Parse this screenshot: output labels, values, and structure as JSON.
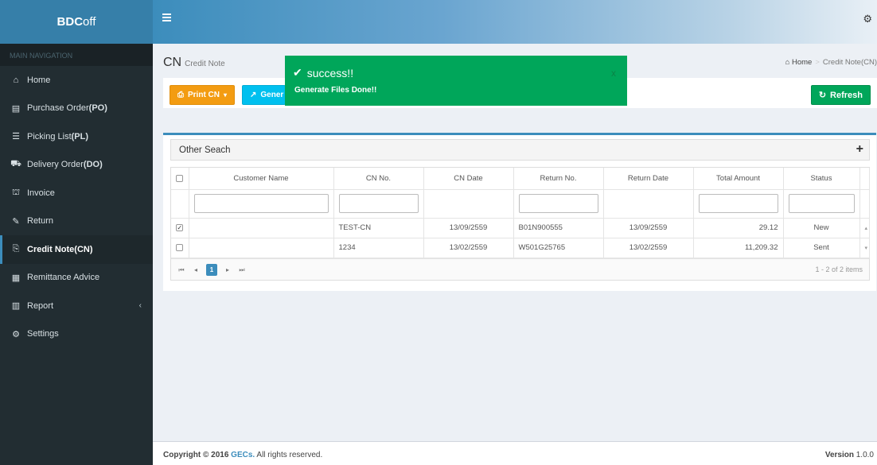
{
  "brand": {
    "bold": "BDC",
    "rest": "off"
  },
  "sidebar": {
    "header": "MAIN NAVIGATION",
    "items": [
      {
        "icon": "home-icon",
        "label": "Home",
        "abbr": ""
      },
      {
        "icon": "file-icon",
        "label": "Purchase Order ",
        "abbr": "(PO)"
      },
      {
        "icon": "list-icon",
        "label": "Picking List ",
        "abbr": "(PL)"
      },
      {
        "icon": "truck-icon",
        "label": "Delivery Order ",
        "abbr": "(DO)"
      },
      {
        "icon": "bank-icon",
        "label": "Invoice",
        "abbr": ""
      },
      {
        "icon": "edit-icon",
        "label": "Return",
        "abbr": ""
      },
      {
        "icon": "credit-note-icon",
        "label": "Credit Note ",
        "abbr": "(CN)"
      },
      {
        "icon": "calendar-icon",
        "label": "Remittance Advice",
        "abbr": ""
      },
      {
        "icon": "chart-icon",
        "label": "Report",
        "abbr": ""
      },
      {
        "icon": "settings-icon",
        "label": "Settings",
        "abbr": ""
      }
    ],
    "active_index": 6
  },
  "header": {
    "title": "CN",
    "subtitle": "Credit Note"
  },
  "breadcrumb": {
    "home": "Home",
    "current": "Credit Note(CN)"
  },
  "toolbar": {
    "print_label": "Print CN",
    "generate_label": "Gener",
    "refresh_label": "Refresh"
  },
  "toast": {
    "title": "success!!",
    "message": "Generate Files Done!!",
    "close": "x"
  },
  "search": {
    "label": "Other Seach",
    "toggle": "+"
  },
  "grid": {
    "columns": [
      "Customer Name",
      "CN No.",
      "CN Date",
      "Return No.",
      "Return Date",
      "Total Amount",
      "Status"
    ],
    "rows": [
      {
        "checked": true,
        "customer": "",
        "cn_no": "TEST-CN",
        "cn_date": "13/09/2559",
        "return_no": "B01N900555",
        "return_date": "13/09/2559",
        "total": "29.12",
        "status": "New"
      },
      {
        "checked": false,
        "customer": "",
        "cn_no": "1234",
        "cn_date": "13/02/2559",
        "return_no": "W501G25765",
        "return_date": "13/02/2559",
        "total": "11,209.32",
        "status": "Sent"
      }
    ],
    "pager": {
      "current_page": "1",
      "info": "1 - 2 of 2 items"
    }
  },
  "footer": {
    "copy_prefix": "Copyright © 2016 ",
    "company": "GECs.",
    "copy_suffix": " All rights reserved.",
    "version_label": "Version",
    "version": " 1.0.0"
  },
  "colors": {
    "sidebar": "#222d32",
    "brand": "#367fa9",
    "primary": "#3c8dbc",
    "success": "#00a65a",
    "warning": "#f39c12",
    "info": "#00c0ef"
  }
}
